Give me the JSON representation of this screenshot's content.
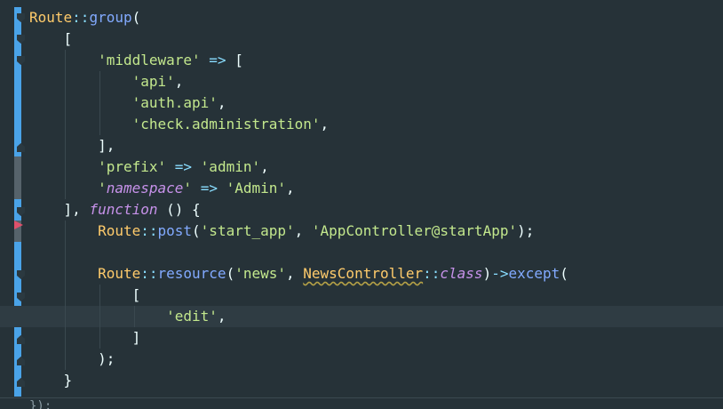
{
  "editor": {
    "background": "#263238",
    "colors": {
      "class": "#ffcb6b",
      "operator": "#89ddff",
      "function": "#82aaff",
      "string": "#c3e88d",
      "keyword": "#c792ea",
      "text": "#eeffff",
      "gutter_marker": "#4aa3e8"
    },
    "lines": [
      {
        "tokens": [
          {
            "t": "Route",
            "c": "class"
          },
          {
            "t": "::",
            "c": "op"
          },
          {
            "t": "group",
            "c": "fn"
          },
          {
            "t": "(",
            "c": "plain"
          }
        ]
      },
      {
        "tokens": [
          {
            "t": "    [",
            "c": "plain"
          }
        ]
      },
      {
        "tokens": [
          {
            "t": "        ",
            "c": "plain"
          },
          {
            "t": "'middleware'",
            "c": "str"
          },
          {
            "t": " ",
            "c": "plain"
          },
          {
            "t": "=>",
            "c": "op"
          },
          {
            "t": " [",
            "c": "plain"
          }
        ]
      },
      {
        "tokens": [
          {
            "t": "            ",
            "c": "plain"
          },
          {
            "t": "'api'",
            "c": "str"
          },
          {
            "t": ",",
            "c": "plain"
          }
        ]
      },
      {
        "tokens": [
          {
            "t": "            ",
            "c": "plain"
          },
          {
            "t": "'auth.api'",
            "c": "str"
          },
          {
            "t": ",",
            "c": "plain"
          }
        ]
      },
      {
        "tokens": [
          {
            "t": "            ",
            "c": "plain"
          },
          {
            "t": "'check.administration'",
            "c": "str"
          },
          {
            "t": ",",
            "c": "plain"
          }
        ]
      },
      {
        "tokens": [
          {
            "t": "        ],",
            "c": "plain"
          }
        ]
      },
      {
        "tokens": [
          {
            "t": "        ",
            "c": "plain"
          },
          {
            "t": "'prefix'",
            "c": "str"
          },
          {
            "t": " ",
            "c": "plain"
          },
          {
            "t": "=>",
            "c": "op"
          },
          {
            "t": " ",
            "c": "plain"
          },
          {
            "t": "'admin'",
            "c": "str"
          },
          {
            "t": ",",
            "c": "plain"
          }
        ]
      },
      {
        "tokens": [
          {
            "t": "        ",
            "c": "plain"
          },
          {
            "t": "'",
            "c": "str"
          },
          {
            "t": "namespace",
            "c": "ital"
          },
          {
            "t": "'",
            "c": "str"
          },
          {
            "t": " ",
            "c": "plain"
          },
          {
            "t": "=>",
            "c": "op"
          },
          {
            "t": " ",
            "c": "plain"
          },
          {
            "t": "'Admin'",
            "c": "str"
          },
          {
            "t": ",",
            "c": "plain"
          }
        ]
      },
      {
        "tokens": [
          {
            "t": "    ], ",
            "c": "plain"
          },
          {
            "t": "function",
            "c": "kw"
          },
          {
            "t": " () {",
            "c": "plain"
          }
        ]
      },
      {
        "tokens": [
          {
            "t": "        ",
            "c": "plain"
          },
          {
            "t": "Route",
            "c": "class"
          },
          {
            "t": "::",
            "c": "op"
          },
          {
            "t": "post",
            "c": "fn"
          },
          {
            "t": "(",
            "c": "plain"
          },
          {
            "t": "'start_app'",
            "c": "str"
          },
          {
            "t": ", ",
            "c": "plain"
          },
          {
            "t": "'AppController@startApp'",
            "c": "str"
          },
          {
            "t": ");",
            "c": "plain"
          }
        ]
      },
      {
        "tokens": []
      },
      {
        "tokens": [
          {
            "t": "        ",
            "c": "plain"
          },
          {
            "t": "Route",
            "c": "class"
          },
          {
            "t": "::",
            "c": "op"
          },
          {
            "t": "resource",
            "c": "fn"
          },
          {
            "t": "(",
            "c": "plain"
          },
          {
            "t": "'news'",
            "c": "str"
          },
          {
            "t": ", ",
            "c": "plain"
          },
          {
            "t": "NewsController",
            "c": "under"
          },
          {
            "t": "::",
            "c": "op"
          },
          {
            "t": "class",
            "c": "kw"
          },
          {
            "t": ")",
            "c": "plain"
          },
          {
            "t": "->",
            "c": "op"
          },
          {
            "t": "except",
            "c": "fn"
          },
          {
            "t": "(",
            "c": "plain"
          }
        ]
      },
      {
        "tokens": [
          {
            "t": "            [",
            "c": "plain"
          }
        ]
      },
      {
        "tokens": [
          {
            "t": "                ",
            "c": "plain"
          },
          {
            "t": "'edit'",
            "c": "str"
          },
          {
            "t": ",",
            "c": "plain"
          }
        ]
      },
      {
        "tokens": [
          {
            "t": "            ]",
            "c": "plain"
          }
        ]
      },
      {
        "tokens": [
          {
            "t": "        );",
            "c": "plain"
          }
        ]
      },
      {
        "tokens": [
          {
            "t": "    }",
            "c": "plain"
          }
        ]
      }
    ],
    "bottom_text": "});"
  }
}
